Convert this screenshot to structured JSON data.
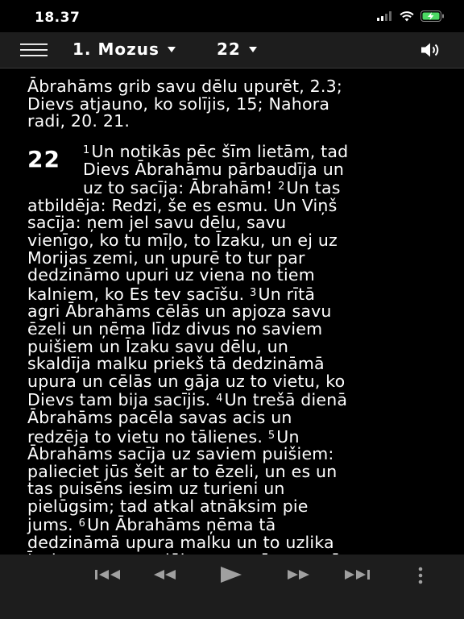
{
  "status_bar": {
    "time": "18.37"
  },
  "header": {
    "book": "1. Mozus",
    "chapter": "22"
  },
  "content": {
    "summary_lines": [
      "Ābrahāms grib savu dēlu upurēt, 2.3;",
      "Dievs atjauno, ko solījis, 15; Nahora",
      "radi, 20. 21."
    ],
    "chapter_number": "22",
    "lines": [
      {
        "parts": [
          {
            "v": "1"
          },
          {
            "t": "Un notikās pēc šīm lietām, tad"
          }
        ]
      },
      {
        "parts": [
          {
            "t": "Dievs Ābrahāmu pārbaudīja un"
          }
        ]
      },
      {
        "parts": [
          {
            "t": "uz to sacīja: Ābrahām! "
          },
          {
            "v": "2"
          },
          {
            "t": "Un tas"
          }
        ]
      },
      {
        "parts": [
          {
            "t": "atbildēja: Redzi, še es esmu. Un Viņš"
          }
        ]
      },
      {
        "parts": [
          {
            "t": "sacīja: ņem jel savu dēlu, savu"
          }
        ]
      },
      {
        "parts": [
          {
            "t": "vienīgo, ko tu mīļo, to Īzaku, un ej uz"
          }
        ]
      },
      {
        "parts": [
          {
            "t": "Morijas zemi, un upurē to tur par"
          }
        ]
      },
      {
        "parts": [
          {
            "t": "dedzināmo upuri uz viena no tiem"
          }
        ]
      },
      {
        "parts": [
          {
            "t": "kalniem, ko Es tev sacīšu. "
          },
          {
            "v": "3"
          },
          {
            "t": "Un rītā"
          }
        ]
      },
      {
        "parts": [
          {
            "t": "agri Ābrahāms cēlās un apjoza savu"
          }
        ]
      },
      {
        "parts": [
          {
            "t": "ēzeli un ņēma līdz divus no saviem"
          }
        ]
      },
      {
        "parts": [
          {
            "t": "puišiem un Īzaku savu dēlu, un"
          }
        ]
      },
      {
        "parts": [
          {
            "t": "skaldīja malku priekš tā dedzināmā"
          }
        ]
      },
      {
        "parts": [
          {
            "t": "upura un cēlās un gāja uz to vietu, ko"
          }
        ]
      },
      {
        "parts": [
          {
            "t": "Dievs tam bija sacījis. "
          },
          {
            "v": "4"
          },
          {
            "t": "Un trešā dienā"
          }
        ]
      },
      {
        "parts": [
          {
            "t": "Ābrahāms pacēla savas acis un"
          }
        ]
      },
      {
        "parts": [
          {
            "t": "redzēja to vietu no tālienes. "
          },
          {
            "v": "5"
          },
          {
            "t": "Un"
          }
        ]
      },
      {
        "parts": [
          {
            "t": "Ābrahāms sacīja uz saviem puišiem:"
          }
        ]
      },
      {
        "parts": [
          {
            "t": "palieciet jūs šeit ar to ēzeli, un es un"
          }
        ]
      },
      {
        "parts": [
          {
            "t": "tas puisēns iesim uz turieni un"
          }
        ]
      },
      {
        "parts": [
          {
            "t": "pielūgsim; tad atkal atnāksim pie"
          }
        ]
      },
      {
        "parts": [
          {
            "t": "jums. "
          },
          {
            "v": "6"
          },
          {
            "t": "Un Ābrahāms ņēma tā"
          }
        ]
      },
      {
        "parts": [
          {
            "t": "dedzināmā upura malku un to uzlika"
          }
        ]
      },
      {
        "parts": [
          {
            "t": "Īzakam, savam dēlam, un ņēma savā"
          }
        ]
      }
    ]
  },
  "colors": {
    "background": "#000000",
    "bar": "#1d1d1d",
    "text": "#ffffff",
    "controls": "#a0a0a0",
    "battery_charge": "#4cd964"
  }
}
